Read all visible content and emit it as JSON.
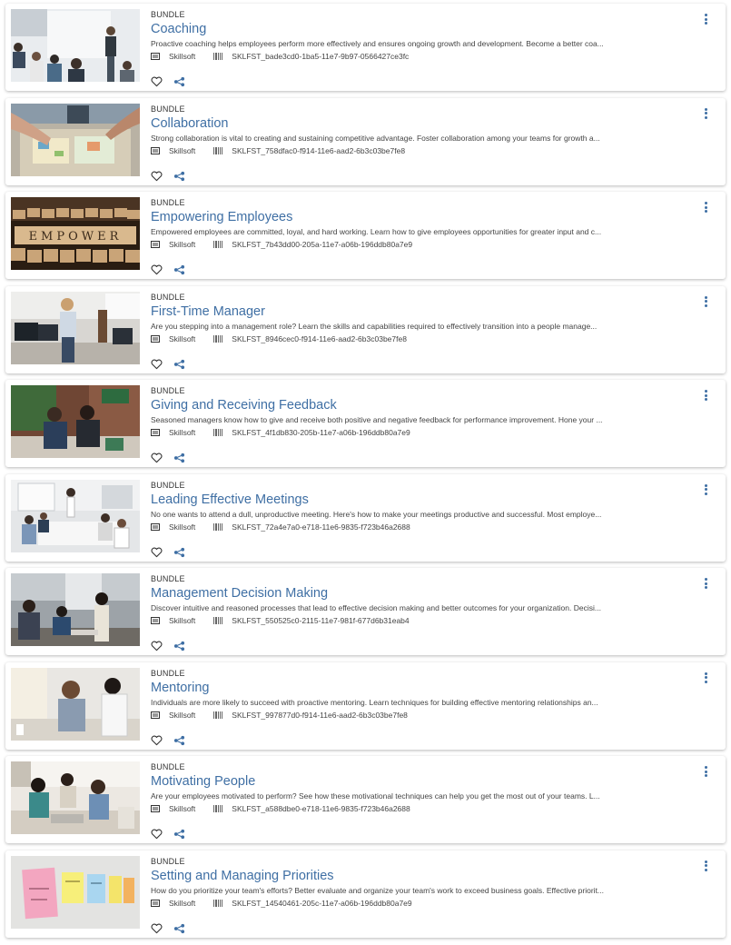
{
  "items": [
    {
      "type": "BUNDLE",
      "title": "Coaching",
      "description": "Proactive coaching helps employees perform more effectively and ensures ongoing growth and development. Become a better coa...",
      "vendor": "Skillsoft",
      "code": "SKLFST_bade3cd0-1ba5-11e7-9b97-0566427ce3fc",
      "image": "presenter-icon"
    },
    {
      "type": "BUNDLE",
      "title": "Collaboration",
      "description": "Strong collaboration is vital to creating and sustaining competitive advantage. Foster collaboration among your teams for growth a...",
      "vendor": "Skillsoft",
      "code": "SKLFST_758dfac0-f914-11e6-aad2-6b3c03be7fe8",
      "image": "hands-table-icon"
    },
    {
      "type": "BUNDLE",
      "title": "Empowering Employees",
      "description": "Empowered employees are committed, loyal, and hard working. Learn how to give employees opportunities for greater input and c...",
      "vendor": "Skillsoft",
      "code": "SKLFST_7b43dd00-205a-11e7-a06b-196ddb80a7e9",
      "image": "letter-blocks-icon",
      "image_text": "EMPOWER"
    },
    {
      "type": "BUNDLE",
      "title": "First-Time Manager",
      "description": "Are you stepping into a management role? Learn the skills and capabilities required to effectively transition into a people manage...",
      "vendor": "Skillsoft",
      "code": "SKLFST_8946cec0-f914-11e6-aad2-6b3c03be7fe8",
      "image": "office-manager-icon"
    },
    {
      "type": "BUNDLE",
      "title": "Giving and Receiving Feedback",
      "description": "Seasoned managers know how to give and receive both positive and negative feedback for performance improvement. Hone your ...",
      "vendor": "Skillsoft",
      "code": "SKLFST_4f1db830-205b-11e7-a06b-196ddb80a7e9",
      "image": "two-people-talking-icon"
    },
    {
      "type": "BUNDLE",
      "title": "Leading Effective Meetings",
      "description": "No one wants to attend a dull, unproductive meeting. Here's how to make your meetings productive and successful. Most employe...",
      "vendor": "Skillsoft",
      "code": "SKLFST_72a4e7a0-e718-11e6-9835-f723b46a2688",
      "image": "meeting-room-icon"
    },
    {
      "type": "BUNDLE",
      "title": "Management Decision Making",
      "description": "Discover intuitive and reasoned processes that lead to effective decision making and better outcomes for your organization. Decisi...",
      "vendor": "Skillsoft",
      "code": "SKLFST_550525c0-2115-11e7-981f-677d6b31eab4",
      "image": "team-discussion-icon"
    },
    {
      "type": "BUNDLE",
      "title": "Mentoring",
      "description": "Individuals are more likely to succeed with proactive mentoring. Learn techniques for building effective mentoring relationships an...",
      "vendor": "Skillsoft",
      "code": "SKLFST_997877d0-f914-11e6-aad2-6b3c03be7fe8",
      "image": "mentor-consoling-icon"
    },
    {
      "type": "BUNDLE",
      "title": "Motivating People",
      "description": "Are your employees motivated to perform? See how these motivational techniques can help you get the most out of your teams. L...",
      "vendor": "Skillsoft",
      "code": "SKLFST_a588dbe0-e718-11e6-9835-f723b46a2688",
      "image": "group-laptop-icon"
    },
    {
      "type": "BUNDLE",
      "title": "Setting and Managing Priorities",
      "description": "How do you prioritize your team's efforts? Better evaluate and organize your team's work to exceed business goals. Effective priorit...",
      "vendor": "Skillsoft",
      "code": "SKLFST_14540461-205c-11e7-a06b-196ddb80a7e9",
      "image": "sticky-notes-icon"
    }
  ],
  "colors": {
    "title": "#3f6fa4",
    "accent": "#3f6fa4",
    "text": "#444444"
  },
  "icons": {
    "vendor": "catalog-icon",
    "code": "barcode-icon",
    "favorite": "heart-outline-icon",
    "share": "share-icon",
    "more": "kebab-menu-icon"
  }
}
